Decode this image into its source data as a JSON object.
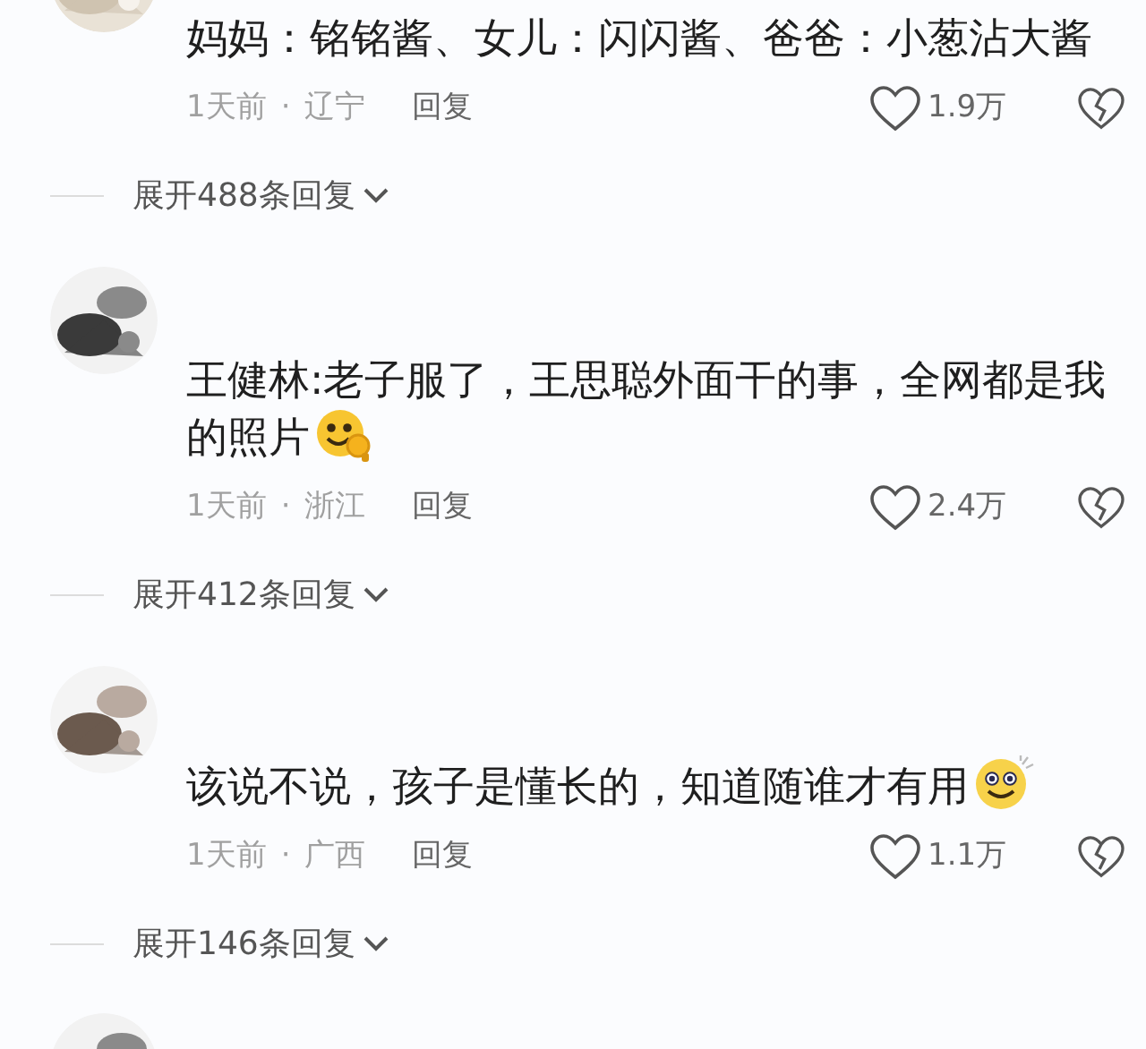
{
  "comments": [
    {
      "text": "妈妈：铭铭酱、女儿：闪闪酱、爸爸：小葱沾大酱",
      "time": "1天前",
      "separator": "·",
      "location": "辽宁",
      "reply": "回复",
      "likes": "1.9万",
      "expand": "展开488条回复"
    },
    {
      "text": "王健林:老子服了，王思聪外面干的事，全网都是我的照片",
      "emoji": {
        "kind": "peek"
      },
      "time": "1天前",
      "separator": "·",
      "location": "浙江",
      "reply": "回复",
      "likes": "2.4万",
      "expand": "展开412条回复"
    },
    {
      "text": "该说不说，孩子是懂长的，知道随谁才有用",
      "emoji": {
        "kind": "dazed"
      },
      "time": "1天前",
      "separator": "·",
      "location": "广西",
      "reply": "回复",
      "likes": "1.1万",
      "expand": "展开146条回复"
    }
  ]
}
